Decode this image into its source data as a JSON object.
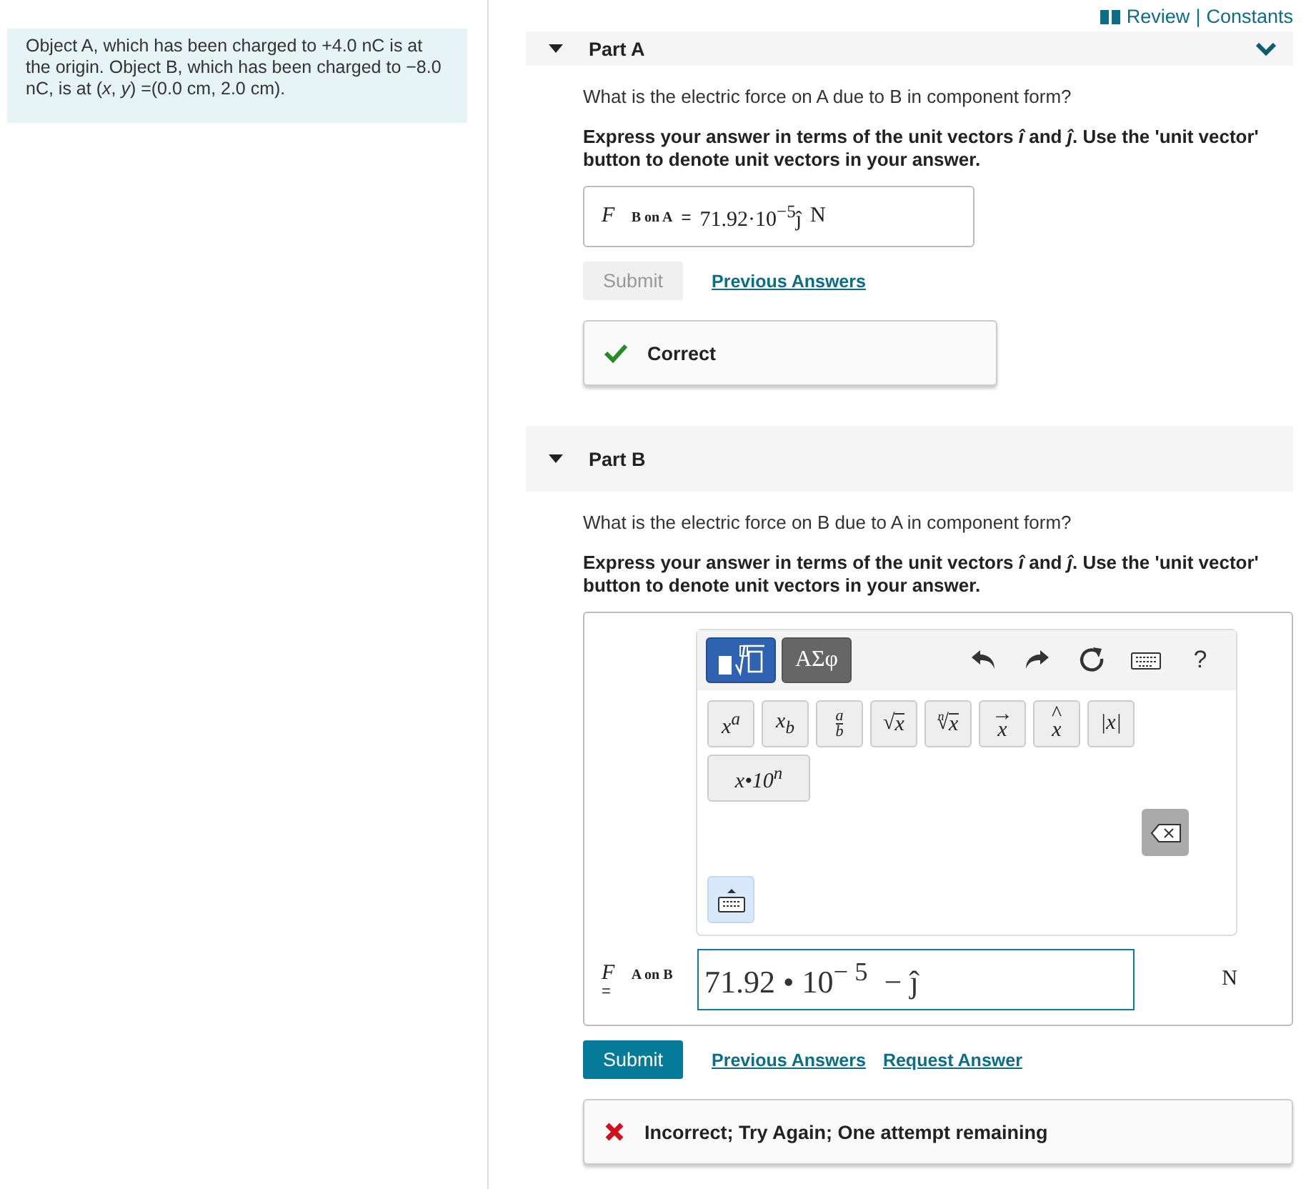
{
  "header": {
    "links": [
      {
        "label": "Review"
      },
      {
        "label": "Constants"
      }
    ],
    "separator": "|"
  },
  "problem": {
    "text": "Object A, which has been charged to +4.0 nC is at the origin. Object B, which has been charged to −8.0 nC, is at (*x*, *y*) =(0.0 cm, 2.0 cm)."
  },
  "parts": [
    {
      "title": "Part A",
      "expanded": true,
      "collapse_toggle": true,
      "question": "What is the electric force on A due to B in component form?",
      "instruction": "Express your answer in terms of the unit vectors *î* and *ĵ*. Use the 'unit vector' button to denote unit vectors in your answer.",
      "answer": {
        "symbol": "F⃗",
        "subscript": "B on A",
        "equals": "=",
        "value": "71.92·10$^{−5}$ĵ",
        "unit": "N"
      },
      "submit": {
        "label": "Submit",
        "disabled": true
      },
      "links": [
        "Previous Answers"
      ],
      "feedback": {
        "kind": "correct",
        "text": "Correct"
      }
    },
    {
      "title": "Part B",
      "expanded": true,
      "question": "What is the electric force on B due to A in component form?",
      "instruction": "Express your answer in terms of the unit vectors *î* and *ĵ*. Use the 'unit vector' button to denote unit vectors in your answer.",
      "editor": {
        "tabs": [
          {
            "kind": "templates",
            "selected": true
          },
          {
            "kind": "greek",
            "label": "ΑΣφ",
            "selected": false
          }
        ],
        "tools": [
          {
            "kind": "undo"
          },
          {
            "kind": "redo"
          },
          {
            "kind": "reset"
          },
          {
            "kind": "keyboard"
          },
          {
            "kind": "help",
            "label": "?"
          }
        ],
        "palette": [
          {
            "kind": "text",
            "label": "x$^{a}$"
          },
          {
            "kind": "text",
            "label": "x$_{b}$"
          },
          {
            "kind": "fraction",
            "top": "a",
            "bottom": "b"
          },
          {
            "kind": "root",
            "radical": "√",
            "body": "x"
          },
          {
            "kind": "root",
            "index": "n",
            "radical": "√",
            "body": "x"
          },
          {
            "kind": "accent",
            "accent": "→",
            "body": "x"
          },
          {
            "kind": "accent",
            "accent": "^",
            "body": "x"
          },
          {
            "kind": "text",
            "label": "|x|"
          },
          {
            "kind": "text",
            "label": "x•10$^{n}$"
          }
        ]
      },
      "answer": {
        "symbol": "F⃗",
        "subscript": "A on B",
        "equals": "=",
        "value": "71.92 • 10$^{− 5}$ − ĵ",
        "unit": "N"
      },
      "submit": {
        "label": "Submit",
        "disabled": false
      },
      "links": [
        "Previous Answers",
        "Request Answer"
      ],
      "feedback": {
        "kind": "incorrect",
        "text": "Incorrect; Try Again; One attempt remaining"
      }
    }
  ]
}
